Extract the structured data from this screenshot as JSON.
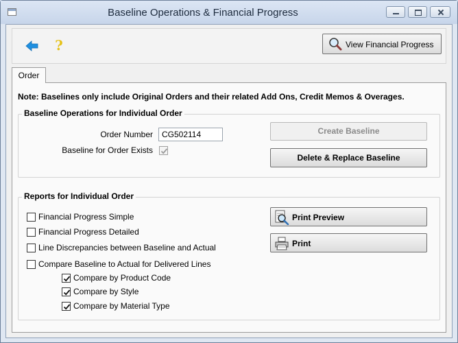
{
  "window": {
    "title": "Baseline Operations & Financial Progress"
  },
  "toolbar": {
    "view_financial_progress_label": "View Financial Progress"
  },
  "tabs": [
    {
      "label": "Order",
      "selected": true
    }
  ],
  "note": "Note:  Baselines only include Original Orders and their related Add Ons, Credit Memos & Overages.",
  "baseline_ops": {
    "title": "Baseline Operations for Individual Order",
    "order_number_label": "Order Number",
    "order_number_value": "CG502114",
    "baseline_exists_label": "Baseline for Order Exists",
    "baseline_exists_checked": true,
    "create_baseline_label": "Create Baseline",
    "delete_replace_label": "Delete & Replace Baseline"
  },
  "reports": {
    "title": "Reports for Individual Order",
    "options": [
      {
        "label": "Financial Progress Simple",
        "checked": false
      },
      {
        "label": "Financial Progress Detailed",
        "checked": false
      },
      {
        "label": "Line Discrepancies between Baseline and Actual",
        "checked": false
      },
      {
        "label": "Compare Baseline to Actual for Delivered Lines",
        "checked": false
      }
    ],
    "sub_options": [
      {
        "label": "Compare by Product Code",
        "checked": true
      },
      {
        "label": "Compare by Style",
        "checked": true
      },
      {
        "label": "Compare by Material Type",
        "checked": true
      }
    ],
    "print_preview_label": "Print Preview",
    "print_label": "Print"
  },
  "colors": {
    "accent_arrow": "#1e8fe0",
    "help_yellow": "#e6c21a"
  }
}
